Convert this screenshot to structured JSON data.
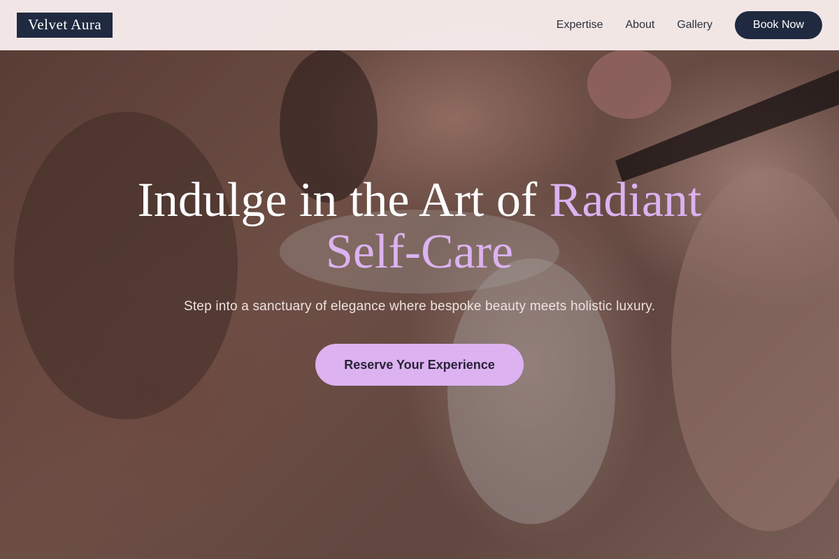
{
  "nav": {
    "logo": "Velvet Aura",
    "links": [
      "Expertise",
      "About",
      "Gallery"
    ],
    "book_label": "Book Now"
  },
  "hero": {
    "title_main": "Indulge in the Art of",
    "title_accent": "Radiant Self-Care",
    "subtitle": "Step into a sanctuary of elegance where bespoke beauty meets holistic luxury.",
    "cta_label": "Reserve Your Experience"
  },
  "colors": {
    "brand_navy": "#1f2a40",
    "accent_lavender": "#dcb2f0"
  }
}
